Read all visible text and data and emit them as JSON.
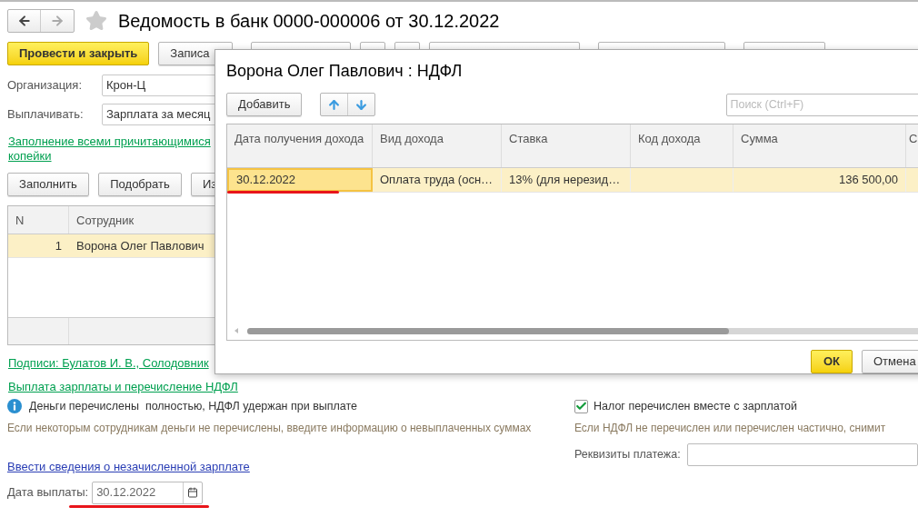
{
  "title": "Ведомость в банк 0000-000006 от 30.12.2022",
  "favorite": false,
  "toolbar": [
    {
      "label": "Провести и закрыть",
      "kind": "primary"
    },
    {
      "label": "Записа",
      "kind": "default"
    }
  ],
  "fields": [
    {
      "label": "Организация:",
      "value": "Крон-Ц"
    },
    {
      "label": "Выплачивать:",
      "value": "Зарплата за месяц"
    }
  ],
  "fill_link": [
    "Заполнение всеми причитающимися",
    "копейки"
  ],
  "table_buttons": [
    "Заполнить",
    "Подобрать",
    "Из"
  ],
  "employees": {
    "columns": [
      "N",
      "Сотрудник"
    ],
    "rows": [
      {
        "n": "1",
        "name": "Ворона Олег Павлович",
        "selected": true
      }
    ]
  },
  "signatures_link": "Подписи: Булатов И. В., Солодовник",
  "payment_link": "Выплата зарплаты и перечисление НДФЛ",
  "info": "Деньги перечислены  полностью, НДФЛ удержан при выплате",
  "hint_left": "Если некоторым сотрудникам деньги не перечислены, введите информацию о невыплаченных суммах",
  "tax_checkbox": {
    "label": "Налог перечислен вместе с зарплатой",
    "checked": true
  },
  "hint_right": "Если НДФЛ не перечислен или перечислен частично, снимит",
  "payment_details": {
    "label": "Реквизиты платежа:"
  },
  "unpaid_link": "Ввести сведения о незачисленной зарплате",
  "payment_date": {
    "label": "Дата выплаты:",
    "value": "30.12.2022",
    "underlined": true
  },
  "dialog": {
    "title": "Ворона Олег Павлович : НДФЛ",
    "add_button": "Добавить",
    "search": {
      "placeholder": "Поиск (Ctrl+F)"
    },
    "columns": [
      "Дата получения дохода",
      "Вид дохода",
      "Ставка",
      "Код дохода",
      "Сумма",
      "С"
    ],
    "rows": [
      {
        "date": "30.12.2022",
        "type": "Оплата труда (осн…",
        "rate": "13% (для нерезид…",
        "amount": "136 500,00",
        "selected": true,
        "underlined": true
      }
    ],
    "ok": "ОК",
    "cancel": "Отмена"
  }
}
